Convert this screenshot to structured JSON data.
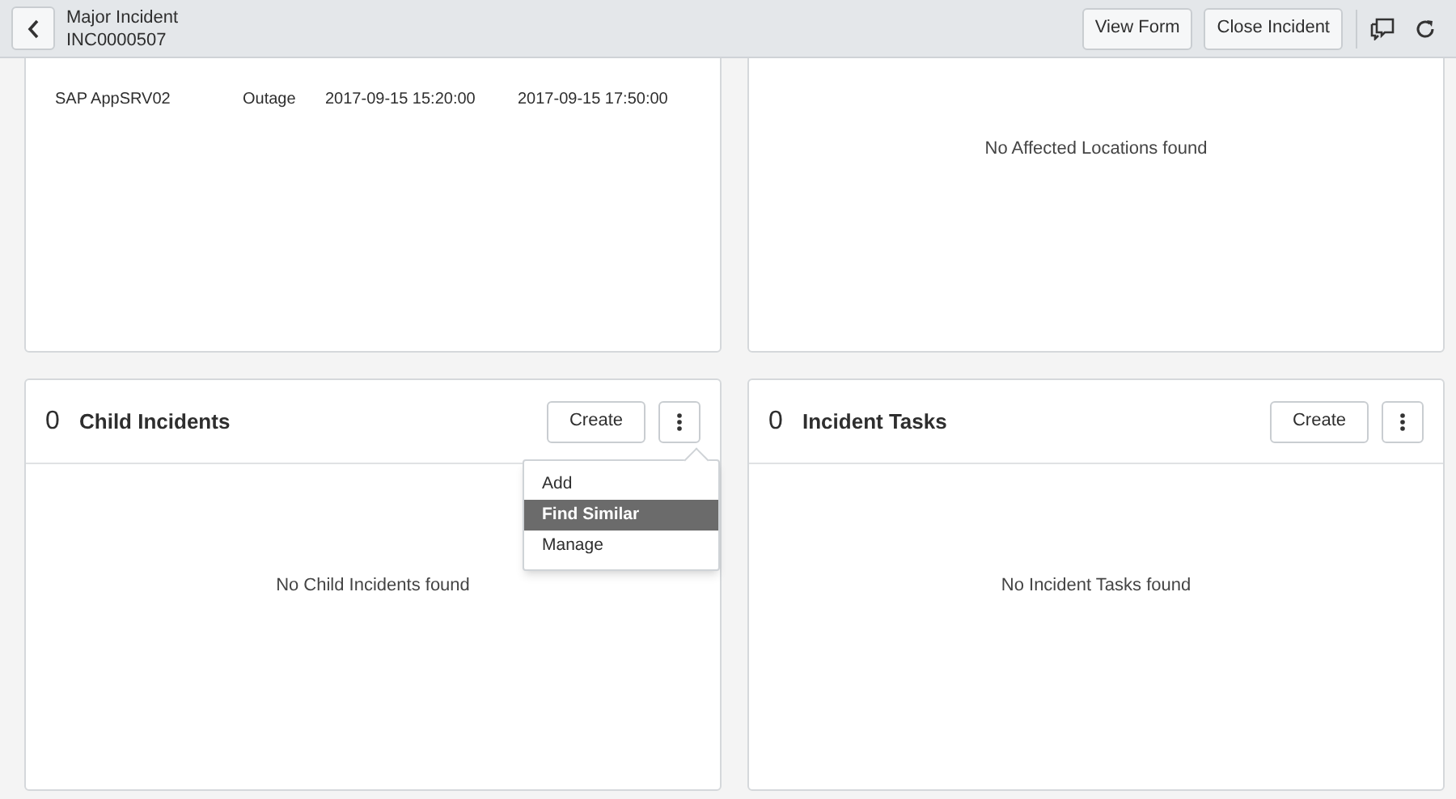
{
  "header": {
    "title": "Major Incident",
    "number": "INC0000507",
    "buttons": [
      "View Form",
      "Close Incident"
    ]
  },
  "outages": {
    "rows": [
      [
        "SAP AppSRV02",
        "Outage",
        "2017-09-15 15:20:00",
        "2017-09-15 17:50:00"
      ]
    ]
  },
  "locations": {
    "empty": "No Affected Locations found"
  },
  "panels": [
    {
      "count": "0",
      "title": "Child Incidents",
      "button": "Create",
      "empty": "No Child Incidents found",
      "menu": [
        {
          "label": "Add",
          "selected": false
        },
        {
          "label": "Find Similar",
          "selected": true
        },
        {
          "label": "Manage",
          "selected": false
        }
      ]
    },
    {
      "count": "0",
      "title": "Incident Tasks",
      "button": "Create",
      "empty": "No Incident Tasks found"
    }
  ]
}
